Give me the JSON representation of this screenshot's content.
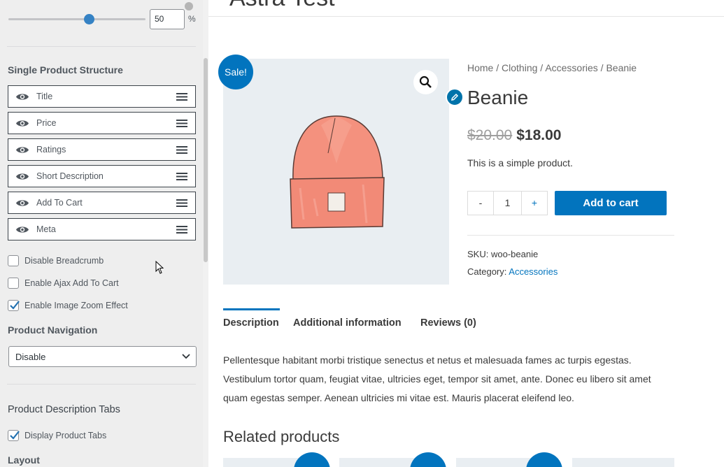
{
  "panel": {
    "slider": {
      "value": "50",
      "unit": "%"
    },
    "structure_title": "Single Product Structure",
    "structure_items": [
      {
        "label": "Title"
      },
      {
        "label": "Price"
      },
      {
        "label": "Ratings"
      },
      {
        "label": "Short Description"
      },
      {
        "label": "Add To Cart"
      },
      {
        "label": "Meta"
      }
    ],
    "checkboxes": [
      {
        "label": "Disable Breadcrumb",
        "checked": false
      },
      {
        "label": "Enable Ajax Add To Cart",
        "checked": false
      },
      {
        "label": "Enable Image Zoom Effect",
        "checked": true
      }
    ],
    "navigation_title": "Product Navigation",
    "navigation_value": "Disable",
    "tabs_title": "Product Description Tabs",
    "display_tabs_label": "Display Product Tabs",
    "layout_title": "Layout"
  },
  "preview": {
    "top_title": "Astra Test",
    "sale_badge": "Sale!",
    "breadcrumb": [
      "Home",
      "Clothing",
      "Accessories",
      "Beanie"
    ],
    "breadcrumb_sep": " / ",
    "title": "Beanie",
    "price_old": "$20.00",
    "price_new": "$18.00",
    "short_description": "This is a simple product.",
    "qty_minus": "-",
    "qty_value": "1",
    "qty_plus": "+",
    "add_to_cart": "Add to cart",
    "sku_label": "SKU:",
    "sku_value": "woo-beanie",
    "category_label": "Category:",
    "category_value": "Accessories",
    "tabs": [
      "Description",
      "Additional information",
      "Reviews (0)"
    ],
    "description": "Pellentesque habitant morbi tristique senectus et netus et malesuada fames ac turpis egestas. Vestibulum tortor quam, feugiat vitae, ultricies eget, tempor sit amet, ante. Donec eu libero sit amet quam egestas semper. Aenean ultricies mi vitae est. Mauris placerat eleifend leo.",
    "related_title": "Related products"
  },
  "colors": {
    "accent": "#0274be",
    "panel_bg": "#eeeeee"
  },
  "icons": [
    "eye-icon",
    "drag-handle-icon",
    "search-icon",
    "pencil-icon",
    "chevron-down-icon",
    "cursor-icon"
  ]
}
